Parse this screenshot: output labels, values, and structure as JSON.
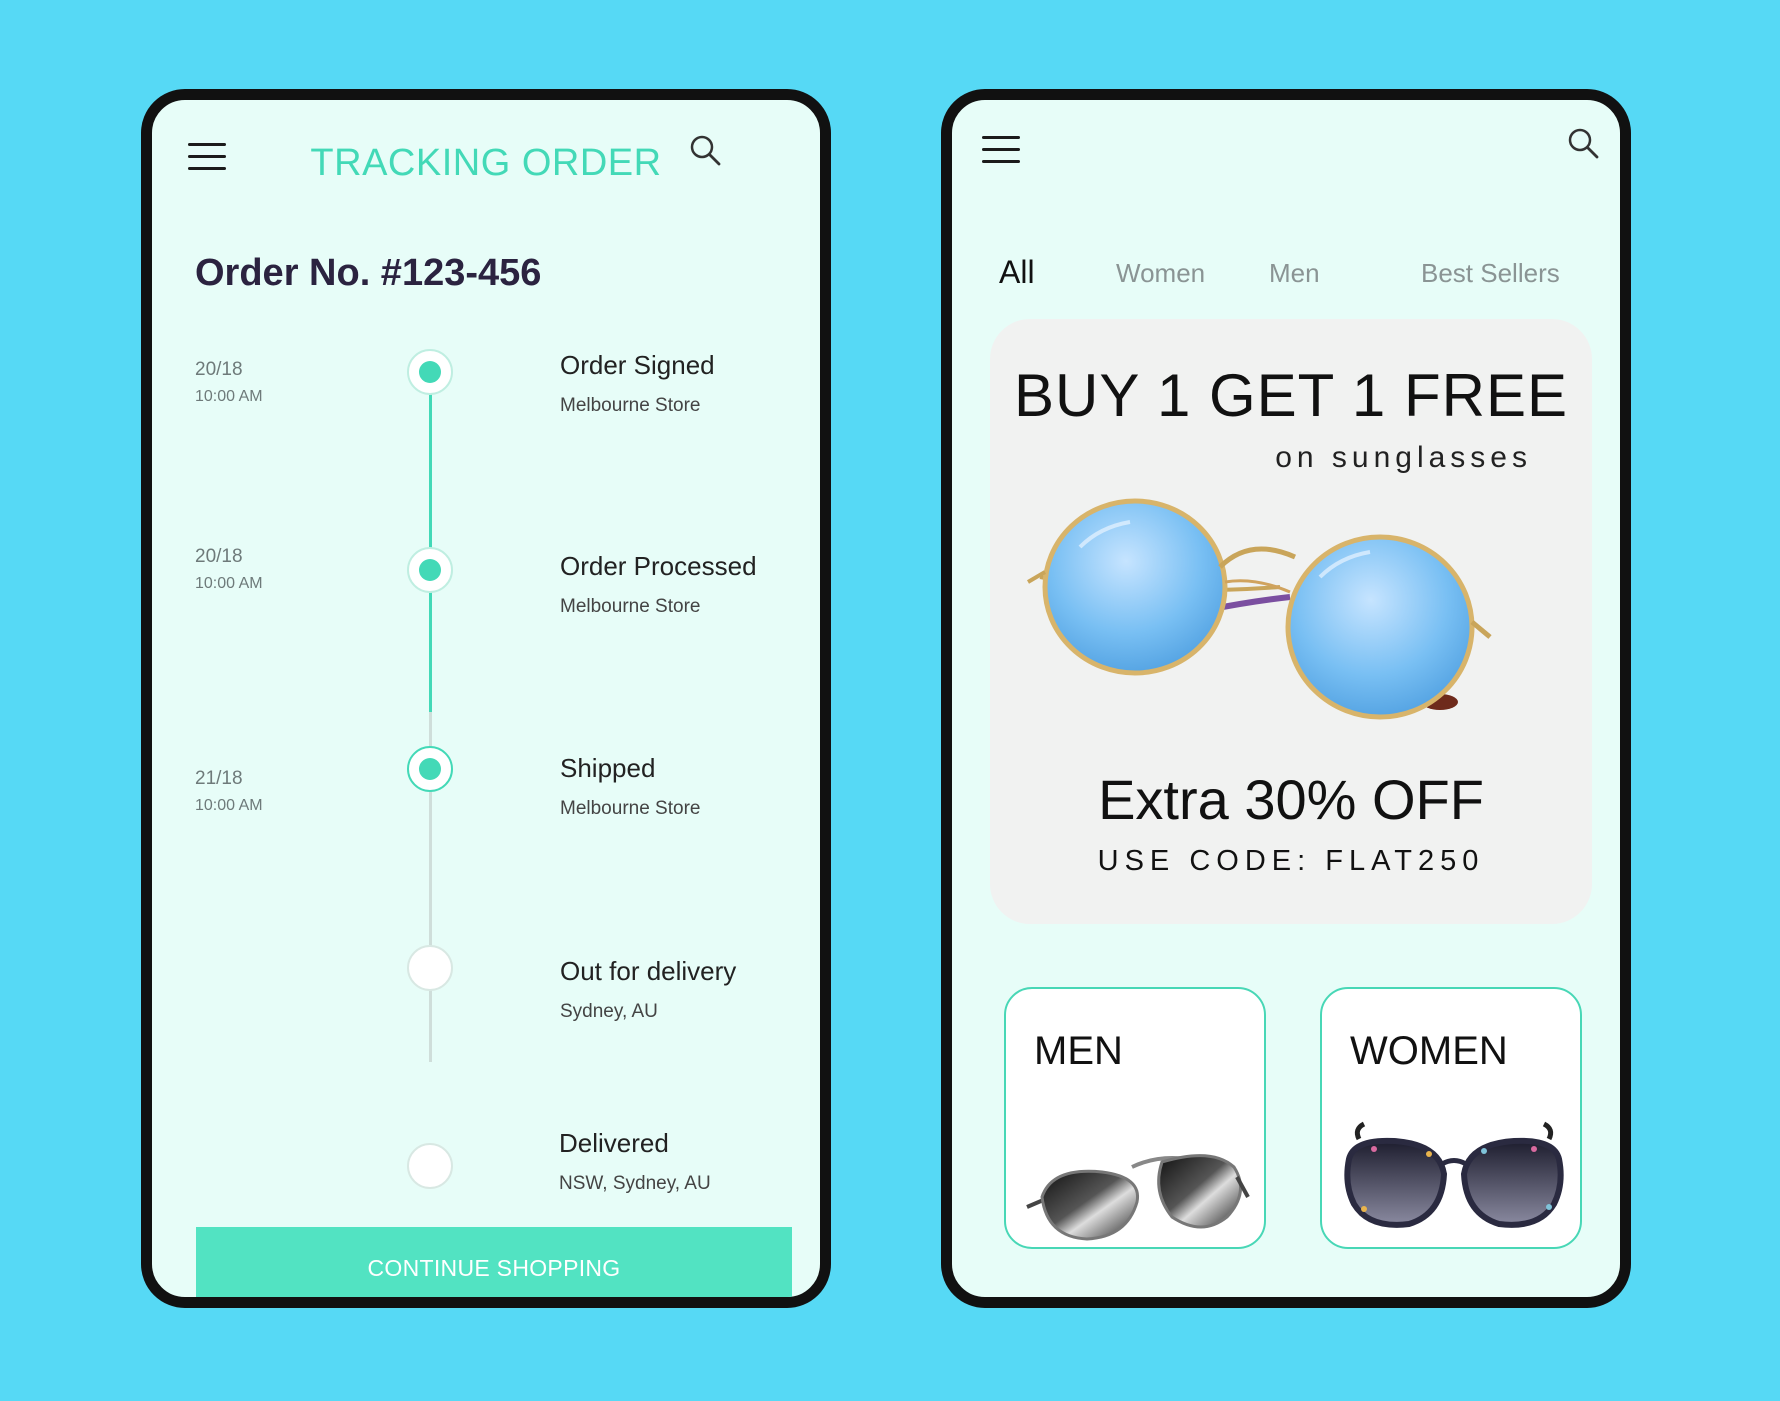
{
  "tracking": {
    "title": "TRACKING ORDER",
    "order_no": "Order No. #123-456",
    "steps": [
      {
        "date": "20/18",
        "time": "10:00 AM",
        "status": "Order Signed",
        "location": "Melbourne Store",
        "state": "done"
      },
      {
        "date": "20/18",
        "time": "10:00 AM",
        "status": "Order Processed",
        "location": "Melbourne Store",
        "state": "done"
      },
      {
        "date": "21/18",
        "time": "10:00 AM",
        "status": "Shipped",
        "location": "Melbourne Store",
        "state": "current"
      },
      {
        "date": "",
        "time": "",
        "status": "Out for delivery",
        "location": "Sydney, AU",
        "state": "pending"
      },
      {
        "date": "",
        "time": "",
        "status": "Delivered",
        "location": "NSW, Sydney, AU",
        "state": "pending"
      }
    ],
    "continue_label": "CONTINUE SHOPPING"
  },
  "shop": {
    "tabs": [
      {
        "label": "All",
        "active": true
      },
      {
        "label": "Women",
        "active": false
      },
      {
        "label": "Men",
        "active": false
      },
      {
        "label": "Best Sellers",
        "active": false
      }
    ],
    "promo": {
      "headline": "BUY 1 GET 1 FREE",
      "subline": "on sunglasses",
      "offer": "Extra 30% OFF",
      "code": "USE CODE: FLAT250"
    },
    "categories": [
      {
        "label": "MEN"
      },
      {
        "label": "WOMEN"
      }
    ]
  },
  "colors": {
    "background": "#56d9f5",
    "screen": "#e7fdf8",
    "accent": "#43d9b7",
    "button": "#52e3c2",
    "promo_bg": "#f1f2f1"
  },
  "icons": [
    "menu-icon",
    "search-icon"
  ]
}
